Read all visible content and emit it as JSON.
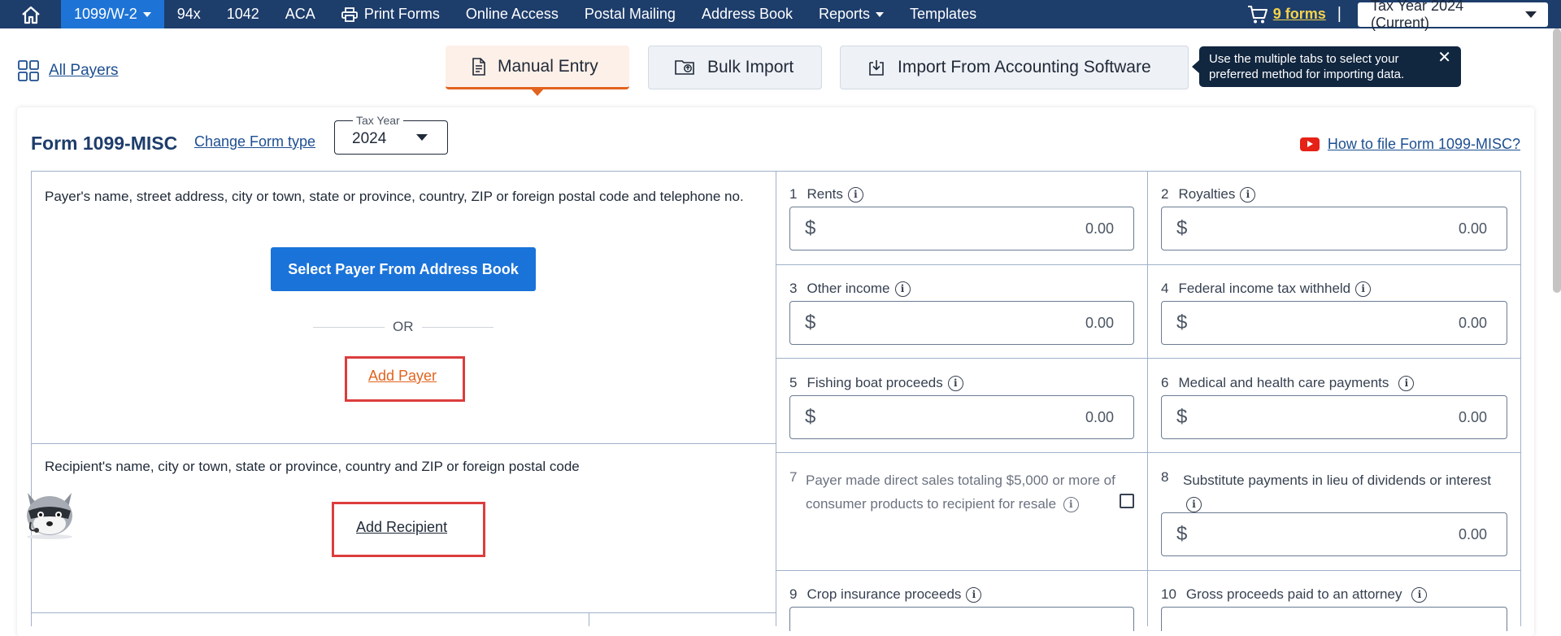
{
  "nav": {
    "items": [
      {
        "label": "1099/W-2",
        "active": true,
        "dropdown": true
      },
      {
        "label": "94x"
      },
      {
        "label": "1042"
      },
      {
        "label": "ACA"
      },
      {
        "label": "Print Forms",
        "icon": "printer-icon"
      },
      {
        "label": "Online Access"
      },
      {
        "label": "Postal Mailing"
      },
      {
        "label": "Address Book"
      },
      {
        "label": "Reports",
        "dropdown": true
      },
      {
        "label": "Templates"
      }
    ],
    "cart_label": "9 forms",
    "separator": "|",
    "tax_year_select": "Tax Year 2024 (Current)"
  },
  "toolbar": {
    "all_payers": "All Payers",
    "tabs": [
      "Manual Entry",
      "Bulk Import",
      "Import From Accounting Software"
    ],
    "tooltip": "Use the multiple tabs to select your preferred method for importing data.",
    "tooltip_close": "✕"
  },
  "form": {
    "title": "Form 1099-MISC",
    "change_type": "Change Form type",
    "tax_year_legend": "Tax Year",
    "tax_year_value": "2024",
    "how_to": "How to file Form 1099-MISC?",
    "payer_label": "Payer's name, street address, city or town, state or province, country, ZIP or foreign postal code and telephone no.",
    "select_payer_button": "Select Payer From Address Book",
    "or_text": "OR",
    "add_payer": "Add Payer",
    "recipient_label": "Recipient's name, city or town, state or province, country and ZIP or foreign postal code",
    "add_recipient": "Add Recipient",
    "currency_symbol": "$",
    "boxes": {
      "b1": {
        "num": "1",
        "label": "Rents",
        "value": "0.00"
      },
      "b2": {
        "num": "2",
        "label": "Royalties",
        "value": "0.00"
      },
      "b3": {
        "num": "3",
        "label": "Other income",
        "value": "0.00"
      },
      "b4": {
        "num": "4",
        "label": "Federal income tax withheld",
        "value": "0.00"
      },
      "b5": {
        "num": "5",
        "label": "Fishing boat proceeds",
        "value": "0.00"
      },
      "b6": {
        "num": "6",
        "label": "Medical and health care payments",
        "value": "0.00"
      },
      "b7": {
        "num": "7",
        "label": "Payer made direct sales totaling $5,000 or more of consumer products to recipient for resale",
        "checked": false
      },
      "b8": {
        "num": "8",
        "label": "Substitute payments in lieu of dividends or interest",
        "value": "0.00"
      },
      "b9": {
        "num": "9",
        "label": "Crop insurance proceeds"
      },
      "b10": {
        "num": "10",
        "label": "Gross proceeds paid to an attorney"
      }
    }
  },
  "colors": {
    "nav_bg": "#1d3d6b",
    "nav_active": "#1e74d6",
    "accent_orange": "#e2631f",
    "primary_button": "#1a73d9",
    "highlight_red": "#dc3d3d"
  }
}
